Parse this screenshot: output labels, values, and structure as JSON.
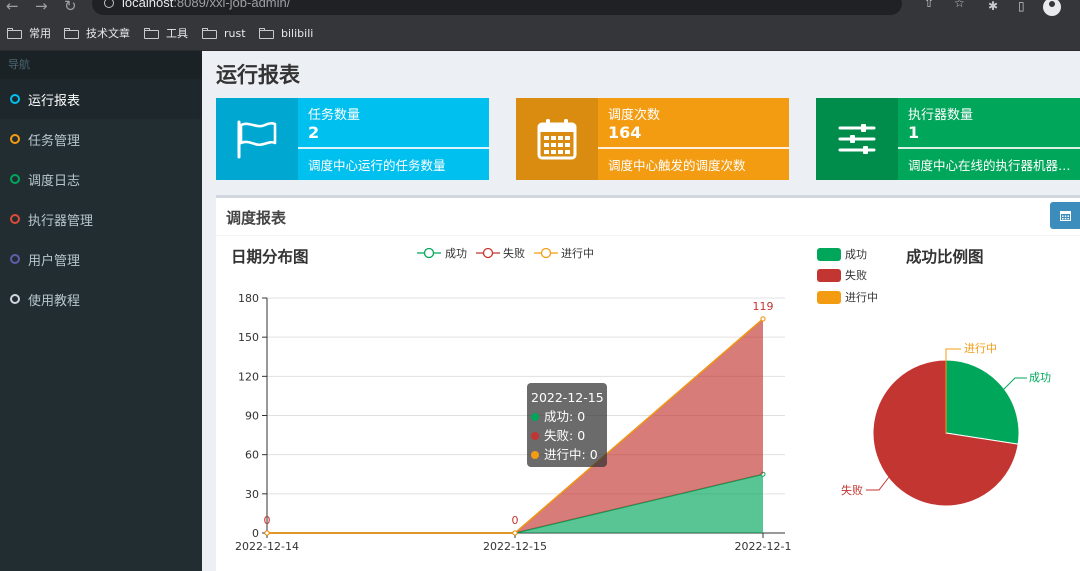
{
  "browser": {
    "url_host": "localhost",
    "url_rest": ":8089/xxl-job-admin/",
    "bookmarks": [
      "常用",
      "技术文章",
      "工具",
      "rust",
      "bilibili"
    ]
  },
  "sidebar": {
    "header": "导航",
    "items": [
      {
        "label": "运行报表",
        "color": "#00c0ef"
      },
      {
        "label": "任务管理",
        "color": "#f39c12"
      },
      {
        "label": "调度日志",
        "color": "#00a65a"
      },
      {
        "label": "执行器管理",
        "color": "#dd4b39"
      },
      {
        "label": "用户管理",
        "color": "#605ca8"
      },
      {
        "label": "使用教程",
        "color": "#d2d6de"
      }
    ]
  },
  "page_title": "运行报表",
  "info_boxes": [
    {
      "label": "任务数量",
      "value": "2",
      "desc": "调度中心运行的任务数量",
      "color": "#00c0ef",
      "icon_bg": "#00a7d0",
      "icon": "flag-icon"
    },
    {
      "label": "调度次数",
      "value": "164",
      "desc": "调度中心触发的调度次数",
      "color": "#f39c12",
      "icon_bg": "#da8c10",
      "icon": "calendar-icon"
    },
    {
      "label": "执行器数量",
      "value": "1",
      "desc": "调度中心在线的执行器机器数量",
      "color": "#00a65a",
      "icon_bg": "#008d4c",
      "icon": "sliders-icon"
    }
  ],
  "panel": {
    "title": "调度报表",
    "button_icon": "calendar-icon"
  },
  "chart_data": [
    {
      "type": "area",
      "title": "日期分布图",
      "categories": [
        "2022-12-14",
        "2022-12-15",
        "2022-12-1"
      ],
      "series": [
        {
          "name": "成功",
          "values": [
            0,
            0,
            45
          ],
          "color": "#00a65a"
        },
        {
          "name": "失败",
          "values": [
            0,
            0,
            119
          ],
          "color": "#c23531"
        },
        {
          "name": "进行中",
          "values": [
            0,
            0,
            0
          ],
          "color": "#f39c12"
        }
      ],
      "stacked": true,
      "ylim": [
        0,
        180
      ],
      "yticks": [
        0,
        30,
        60,
        90,
        120,
        150,
        180
      ],
      "data_labels": [
        {
          "category_index": 0,
          "text": "0"
        },
        {
          "category_index": 1,
          "text": "0"
        },
        {
          "category_index": 2,
          "text": "119"
        }
      ],
      "legend_position": "top-center",
      "tooltip": {
        "title": "2022-12-15",
        "rows": [
          {
            "name": "成功",
            "value": "0",
            "color": "#00a65a"
          },
          {
            "name": "失败",
            "value": "0",
            "color": "#c23531"
          },
          {
            "name": "进行中",
            "value": "0",
            "color": "#f39c12"
          }
        ]
      }
    },
    {
      "type": "pie",
      "title": "成功比例图",
      "slices": [
        {
          "name": "成功",
          "value": 45,
          "color": "#00a65a"
        },
        {
          "name": "失败",
          "value": 119,
          "color": "#c23531"
        },
        {
          "name": "进行中",
          "value": 0,
          "color": "#f39c12"
        }
      ],
      "legend_position": "top-left"
    }
  ]
}
